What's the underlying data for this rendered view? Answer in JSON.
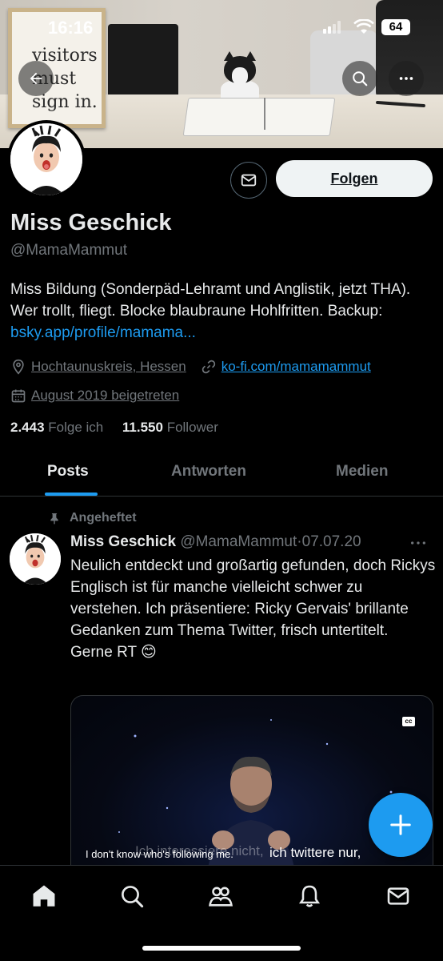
{
  "status_bar": {
    "time": "16:16",
    "battery": "64"
  },
  "banner": {
    "sign_text": [
      "visitors",
      "must",
      "sign in."
    ]
  },
  "profile": {
    "follow_label": "Folgen",
    "name": "Miss Geschick",
    "handle": "@MamaMammut",
    "bio": "Miss Bildung (Sonderpäd-Lehramt und Anglistik, jetzt THA). Wer trollt, fliegt. Blocke blaubraune Hohlfritten. Backup: ",
    "bio_link": "bsky.app/profile/mamama...",
    "location": "Hochtaunuskreis, Hessen",
    "website": "ko-fi.com/mamamammut",
    "joined": "August 2019 beigetreten",
    "following_count": "2.443",
    "following_label": "Folge ich",
    "followers_count": "11.550",
    "followers_label": "Follower"
  },
  "tabs": [
    {
      "label": "Posts",
      "active": true
    },
    {
      "label": "Antworten",
      "active": false
    },
    {
      "label": "Medien",
      "active": false
    }
  ],
  "pinned_post": {
    "pinned_label": "Angeheftet",
    "author_name": "Miss Geschick",
    "author_handle": "@MamaMammut",
    "separator": "·",
    "date": "07.07.20",
    "text": "Neulich entdeckt und großartig gefunden, doch Rickys Englisch ist für manche vielleicht schwer zu verstehen. Ich präsentiere: Ricky Gervais' brillante Gedanken zum Thema Twitter, frisch untertitelt.",
    "text_line2": "Gerne RT 😊",
    "video_subtitle_en": "I don't know who's following me.",
    "video_subtitle_de_faded": "Ich interessiere nicht,",
    "video_subtitle_de": "ich twittere nur,",
    "cc_label": "cc"
  },
  "colors": {
    "accent": "#1d9bf0",
    "background": "#000000",
    "muted": "#71767b",
    "text": "#e7e9ea"
  },
  "icons": {
    "back": "arrow-left-icon",
    "search": "search-icon",
    "more": "more-dots-icon",
    "message": "envelope-icon",
    "location": "location-pin-icon",
    "link": "link-icon",
    "calendar": "calendar-icon",
    "pin": "pin-icon",
    "compose": "plus-icon",
    "nav": [
      "home-icon",
      "search-icon",
      "communities-icon",
      "bell-icon",
      "envelope-icon"
    ]
  }
}
